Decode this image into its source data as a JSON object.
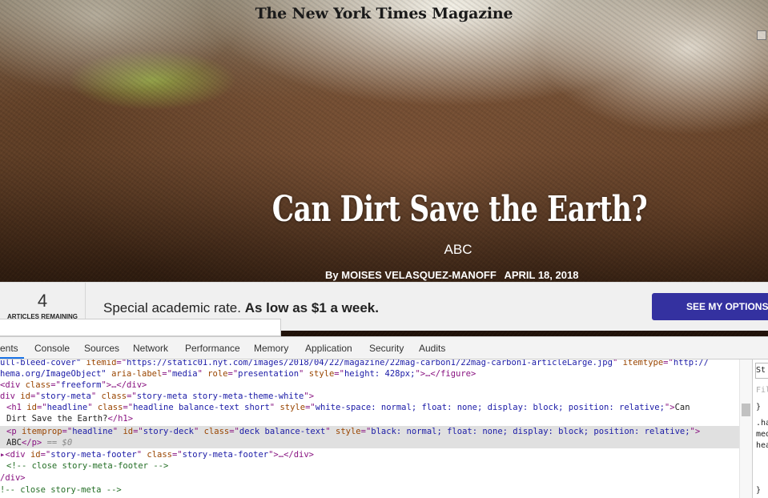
{
  "hero": {
    "masthead": "The New York Times Magazine",
    "headline": "Can Dirt Save the Earth?",
    "deck": "ABC",
    "byline_prefix": "By",
    "author": "MOISES VELASQUEZ-MANOFF",
    "date": "APRIL 18, 2018"
  },
  "paywall": {
    "count": "4",
    "count_label": "ARTICLES REMAINING",
    "offer_text": "Special academic rate.",
    "offer_bold": "As low as $1 a week.",
    "button_label": "SEE MY OPTIONS"
  },
  "devtools": {
    "tabs": [
      "ents",
      "Console",
      "Sources",
      "Network",
      "Performance",
      "Memory",
      "Application",
      "Security",
      "Audits"
    ],
    "active_tab": "Elements",
    "styles_panel": {
      "filter_placeholder": "Filt",
      "rows": [
        "St",
        "}",
        ".ha",
        "med",
        "hea",
        "}"
      ]
    },
    "lines": {
      "l0": {
        "a": "ull-bleed-cover\" ",
        "b": "itemid",
        "c": "=\"",
        "d": "https://static01.nyt.com/images/2018/04/22/magazine/22mag-carbon1/22mag-carbon1-articleLarge.jpg",
        "e": "\" ",
        "f": "itemtype",
        "g": "=\"",
        "h": "http://"
      },
      "l1": {
        "a": "hema.org/ImageObject\" ",
        "b": "aria-label",
        "c": "=\"",
        "d": "media",
        "e": "\" ",
        "f": "role",
        "g": "=\"",
        "h": "presentation",
        "i": "\" ",
        "j": "style",
        "k": "=\"",
        "l": "height: 428px;",
        "m": "\">…</figure>"
      },
      "l2": {
        "a": "<div ",
        "b": "class",
        "c": "=\"",
        "d": "freeform",
        "e": "\">…</div>"
      },
      "l3": {
        "a": "div ",
        "b": "id",
        "c": "=\"",
        "d": "story-meta",
        "e": "\" ",
        "f": "class",
        "g": "=\"",
        "h": "story-meta story-meta-theme-white",
        "i": "\">"
      },
      "l4": {
        "a": "<h1 ",
        "b": "id",
        "c": "=\"",
        "d": "headline",
        "e": "\" ",
        "f": "class",
        "g": "=\"",
        "h": "headline balance-text short",
        "i": "\" ",
        "j": "style",
        "k": "=\"",
        "l": "white-space: normal; float: none; display: block; position: relative;",
        "m": "\">",
        "n": "Can"
      },
      "l5": {
        "a": "Dirt Save the Earth?",
        "b": "</h1>"
      },
      "l6": {
        "a": "<p ",
        "b": "itemprop",
        "c": "=\"",
        "d": "headline",
        "e": "\" ",
        "f": "id",
        "g": "=\"",
        "h": "story-deck",
        "i": "\" ",
        "j": "class",
        "k": "=\"",
        "l": "deck balance-text",
        "m": "\" ",
        "n": "style",
        "o": "=\"",
        "p": "black: normal; float: none; display: block; position: relative;",
        "q": "\">"
      },
      "l7": {
        "a": "ABC",
        "b": "</p>",
        "c": " == $0"
      },
      "l8": {
        "a": "<div ",
        "b": "id",
        "c": "=\"",
        "d": "story-meta-footer",
        "e": "\" ",
        "f": "class",
        "g": "=\"",
        "h": "story-meta-footer",
        "i": "\">…</div>"
      },
      "l9": {
        "a": "<!-- close story-meta-footer -->"
      },
      "l10": {
        "a": "/div>"
      },
      "l11": {
        "a": "!-- close story-meta -->"
      }
    }
  }
}
